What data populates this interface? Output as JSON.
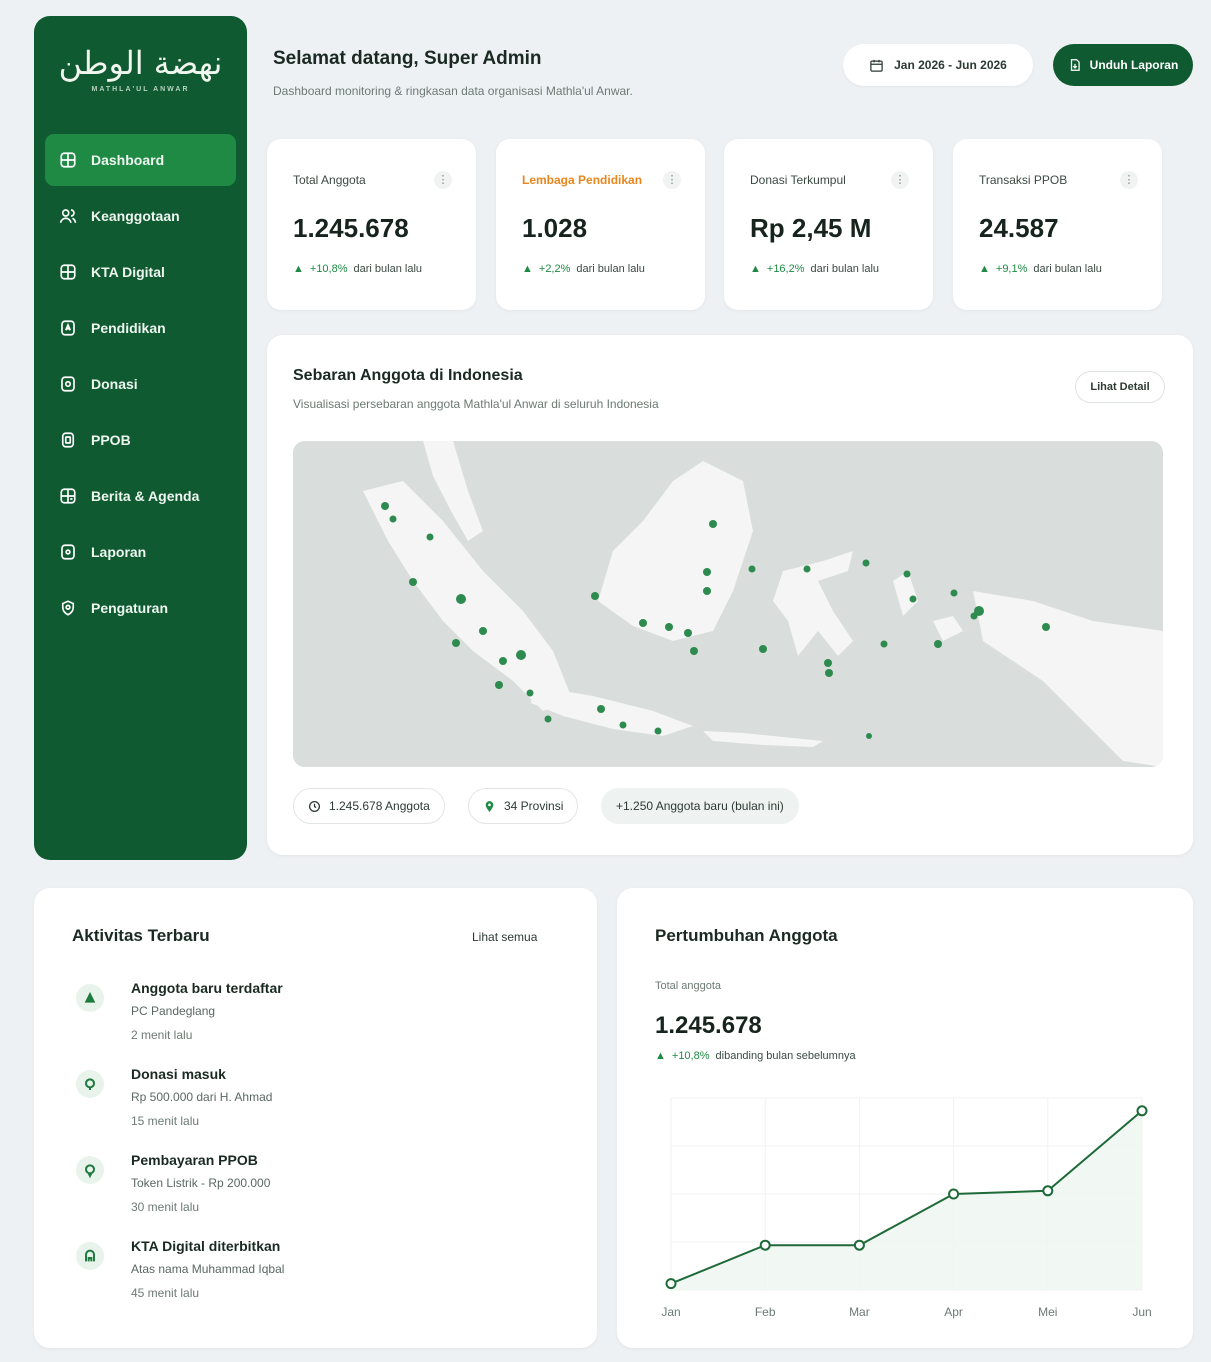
{
  "sidebar": {
    "logo_main": "نهضة الوطن",
    "logo_sub": "MATHLA'UL ANWAR",
    "items": [
      {
        "label": "Dashboard",
        "icon": "dashboard-icon",
        "active": true
      },
      {
        "label": "Keanggotaan",
        "icon": "users-icon"
      },
      {
        "label": "KTA Digital",
        "icon": "id-card-icon"
      },
      {
        "label": "Pendidikan",
        "icon": "school-icon"
      },
      {
        "label": "Donasi",
        "icon": "donation-icon"
      },
      {
        "label": "PPOB",
        "icon": "wallet-icon"
      },
      {
        "label": "Berita & Agenda",
        "icon": "calendar-icon"
      },
      {
        "label": "Laporan",
        "icon": "report-icon"
      },
      {
        "label": "Pengaturan",
        "icon": "settings-icon"
      }
    ]
  },
  "header": {
    "title": "Selamat datang, Super Admin",
    "subtitle": "Dashboard monitoring & ringkasan data organisasi Mathla'ul Anwar.",
    "date_range": "Jan 2026 - Jun 2026",
    "download_label": "Unduh Laporan"
  },
  "stats": [
    {
      "label": "Total Anggota",
      "value": "1.245.678",
      "change": "+10,8%",
      "suffix": "dari bulan lalu",
      "accent": false
    },
    {
      "label": "Lembaga Pendidikan",
      "value": "1.028",
      "change": "+2,2%",
      "suffix": "dari bulan lalu",
      "accent": true
    },
    {
      "label": "Donasi Terkumpul",
      "value": "Rp 2,45 M",
      "change": "+16,2%",
      "suffix": "dari bulan lalu",
      "accent": false
    },
    {
      "label": "Transaksi PPOB",
      "value": "24.587",
      "change": "+9,1%",
      "suffix": "dari bulan lalu",
      "accent": false
    }
  ],
  "map": {
    "title": "Sebaran Anggota di Indonesia",
    "subtitle": "Visualisasi persebaran anggota Mathla'ul Anwar di seluruh Indonesia",
    "detail_label": "Lihat Detail",
    "chips": [
      "1.245.678 Anggota",
      "34 Provinsi",
      "+1.250 Anggota baru (bulan ini)"
    ]
  },
  "activity": {
    "title": "Aktivitas Terbaru",
    "see_all": "Lihat semua",
    "items": [
      {
        "title": "Anggota baru terdaftar",
        "desc": "PC Pandeglang",
        "time": "2 menit lalu",
        "icon": "user-plus-icon"
      },
      {
        "title": "Donasi masuk",
        "desc": "Rp 500.000 dari H. Ahmad",
        "time": "15 menit lalu",
        "icon": "donation-icon"
      },
      {
        "title": "Pembayaran PPOB",
        "desc": "Token Listrik - Rp 200.000",
        "time": "30 menit lalu",
        "icon": "wallet-icon"
      },
      {
        "title": "KTA Digital diterbitkan",
        "desc": "Atas nama Muhammad Iqbal",
        "time": "45 menit lalu",
        "icon": "id-card-icon"
      }
    ]
  },
  "growth": {
    "title": "Pertumbuhan Anggota",
    "label": "Total anggota",
    "value": "1.245.678",
    "change": "+10,8%",
    "suffix": "dibanding bulan sebelumnya"
  },
  "colors": {
    "brand": "#0f5a30",
    "accent": "#1e8a44",
    "orange": "#e8861e"
  },
  "chart_data": {
    "type": "line",
    "categories": [
      "Jan",
      "Feb",
      "Mar",
      "Apr",
      "Mei",
      "Jun"
    ],
    "series": [
      {
        "values": [
          1,
          7,
          7,
          15,
          15.5,
          28
        ]
      }
    ],
    "ylim": [
      0,
      30
    ],
    "grid": true
  }
}
